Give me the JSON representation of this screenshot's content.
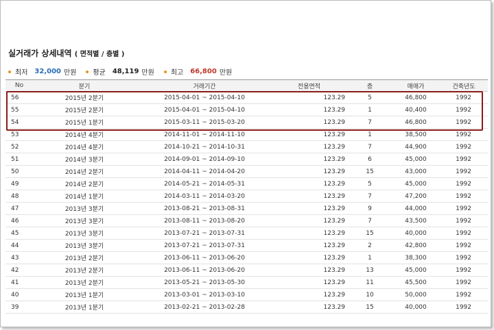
{
  "title": "실거래가 상세내역",
  "subtitle": "( 면적별 / 층별 )",
  "summary": [
    {
      "label": "최저",
      "value": "32,000",
      "unit": "만원",
      "color": "#2a6bb5"
    },
    {
      "label": "평균",
      "value": "48,119",
      "unit": "만원",
      "color": "#222222"
    },
    {
      "label": "최고",
      "value": "66,800",
      "unit": "만원",
      "color": "#c0392b"
    }
  ],
  "columns": [
    "No",
    "분기",
    "거래기간",
    "전용면적",
    "층",
    "매매가",
    "건축년도"
  ],
  "rows": [
    [
      "56",
      "2015년 2분기",
      "2015-04-01 ~ 2015-04-10",
      "123.29",
      "5",
      "46,800",
      "1992"
    ],
    [
      "55",
      "2015년 2분기",
      "2015-04-01 ~ 2015-04-10",
      "123.29",
      "1",
      "40,400",
      "1992"
    ],
    [
      "54",
      "2015년 1분기",
      "2015-03-11 ~ 2015-03-20",
      "123.29",
      "7",
      "46,800",
      "1992"
    ],
    [
      "53",
      "2014년 4분기",
      "2014-11-01 ~ 2014-11-10",
      "123.29",
      "1",
      "38,500",
      "1992"
    ],
    [
      "52",
      "2014년 4분기",
      "2014-10-21 ~ 2014-10-31",
      "123.29",
      "7",
      "44,900",
      "1992"
    ],
    [
      "51",
      "2014년 3분기",
      "2014-09-01 ~ 2014-09-10",
      "123.29",
      "6",
      "45,000",
      "1992"
    ],
    [
      "50",
      "2014년 2분기",
      "2014-04-11 ~ 2014-04-20",
      "123.29",
      "15",
      "43,000",
      "1992"
    ],
    [
      "49",
      "2014년 2분기",
      "2014-05-21 ~ 2014-05-31",
      "123.29",
      "5",
      "45,000",
      "1992"
    ],
    [
      "48",
      "2014년 1분기",
      "2014-03-11 ~ 2014-03-20",
      "123.29",
      "7",
      "47,200",
      "1992"
    ],
    [
      "47",
      "2013년 3분기",
      "2013-08-21 ~ 2013-08-31",
      "123.29",
      "9",
      "44,000",
      "1992"
    ],
    [
      "46",
      "2013년 3분기",
      "2013-08-11 ~ 2013-08-20",
      "123.29",
      "7",
      "43,500",
      "1992"
    ],
    [
      "45",
      "2013년 3분기",
      "2013-07-21 ~ 2013-07-31",
      "123.29",
      "15",
      "40,000",
      "1992"
    ],
    [
      "44",
      "2013년 3분기",
      "2013-07-21 ~ 2013-07-31",
      "123.29",
      "2",
      "42,800",
      "1992"
    ],
    [
      "43",
      "2013년 2분기",
      "2013-06-11 ~ 2013-06-20",
      "123.29",
      "1",
      "38,300",
      "1992"
    ],
    [
      "42",
      "2013년 2분기",
      "2013-06-11 ~ 2013-06-20",
      "123.29",
      "13",
      "45,000",
      "1992"
    ],
    [
      "41",
      "2013년 2분기",
      "2013-05-21 ~ 2013-05-30",
      "123.29",
      "11",
      "45,500",
      "1992"
    ],
    [
      "40",
      "2013년 1분기",
      "2013-03-01 ~ 2013-03-10",
      "123.29",
      "10",
      "50,000",
      "1992"
    ],
    [
      "39",
      "2013년 1분기",
      "2013-02-21 ~ 2013-02-28",
      "123.29",
      "15",
      "40,000",
      "1992"
    ]
  ]
}
